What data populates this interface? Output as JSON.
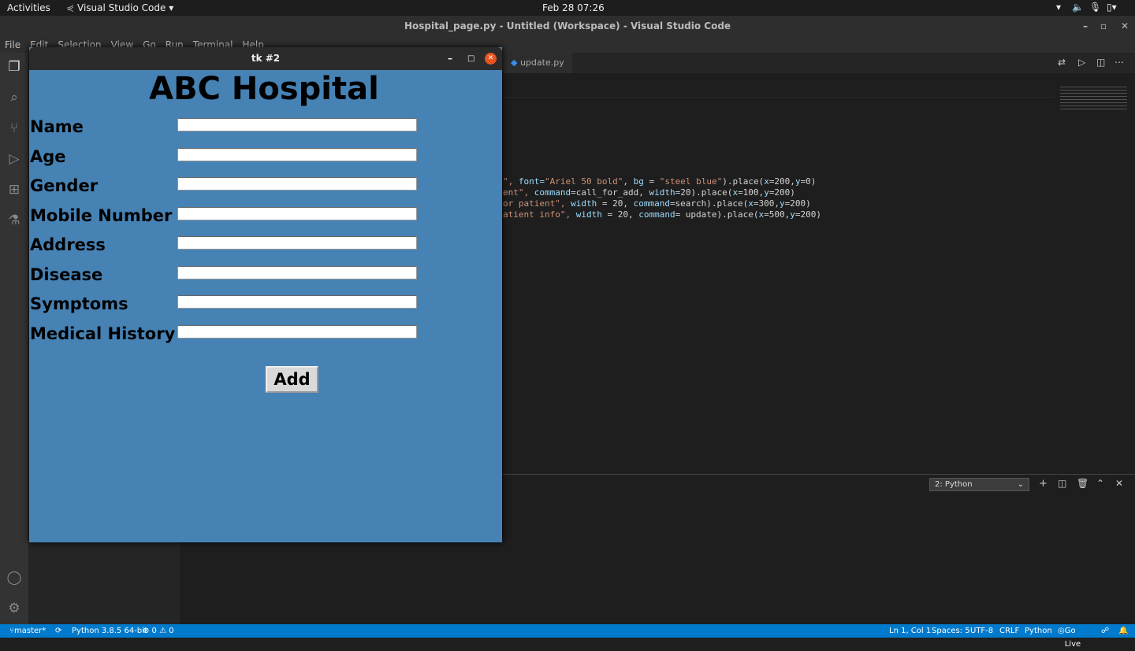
{
  "topbar": {
    "activities": "Activities",
    "app": "Visual Studio Code ▾",
    "clock": "Feb 28  07:26"
  },
  "window": {
    "title": "Hospital_page.py - Untitled (Workspace) - Visual Studio Code"
  },
  "menu": [
    "File",
    "Edit",
    "Selection",
    "View",
    "Go",
    "Run",
    "Terminal",
    "Help"
  ],
  "editor": {
    "tab": "update.py",
    "code": [
      [
        "\", ",
        "font=",
        "\"Ariel 50 bold\"",
        ", ",
        "bg",
        " = ",
        "\"steel blue\"",
        ").place(",
        "x",
        "=200,",
        "y",
        "=0)"
      ],
      [
        "ent\", ",
        "command",
        "=call_for_add, ",
        "width",
        "=20).place(",
        "x",
        "=100,",
        "y",
        "=200)"
      ],
      [
        "or patient\", ",
        "width",
        " = 20, ",
        "command",
        "=search).place(",
        "x",
        "=300,",
        "y",
        "=200)"
      ],
      [
        "atient info\", ",
        "width",
        " = 20, ",
        "command",
        "= update).place(",
        "x",
        "=500,",
        "y",
        "=200)"
      ]
    ]
  },
  "terminal": {
    "selected": "2: Python"
  },
  "status": {
    "branch": "master*",
    "python": "Python 3.8.5 64-bit",
    "problems": "⊗ 0 ⚠ 0",
    "position": "Ln 1, Col 1",
    "spaces": "Spaces: 5",
    "encoding": "UTF-8",
    "eol": "CRLF",
    "language": "Python",
    "golive": "Go Live"
  },
  "tk": {
    "title": "tk #2",
    "app_title": "ABC Hospital",
    "bg": "#4682b4",
    "fields": [
      {
        "label": "Name",
        "value": ""
      },
      {
        "label": "Age",
        "value": ""
      },
      {
        "label": "Gender",
        "value": ""
      },
      {
        "label": "Mobile Number",
        "value": ""
      },
      {
        "label": "Address",
        "value": ""
      },
      {
        "label": "Disease",
        "value": ""
      },
      {
        "label": "Symptoms",
        "value": ""
      },
      {
        "label": "Medical History",
        "value": ""
      }
    ],
    "add_label": "Add"
  }
}
